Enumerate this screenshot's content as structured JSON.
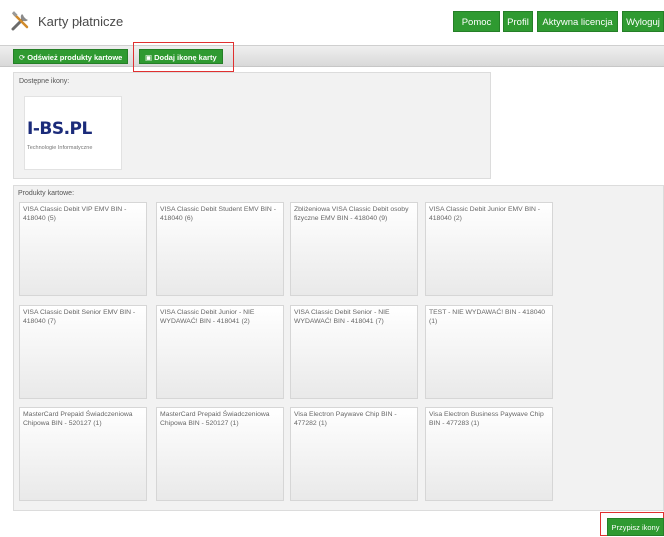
{
  "header": {
    "title": "Karty płatnicze",
    "icon": "tools-icon",
    "nav": [
      "Pomoc",
      "Profil",
      "Aktywna licencja",
      "Wyloguj"
    ]
  },
  "toolbar": {
    "refresh_label": "Odśwież produkty kartowe",
    "refresh_icon": "refresh-icon",
    "add_label": "Dodaj ikonę karty",
    "add_icon": "image-icon"
  },
  "icons_panel": {
    "label": "Dostępne ikony:",
    "logo_text": "I-BS.PL",
    "logo_sub": "Technologie Informatyczne"
  },
  "products": {
    "label": "Produkty kartowe:",
    "items": [
      "VISA Classic Debit VIP EMV BIN - 418040 (5)",
      "VISA Classic Debit Student EMV BIN - 418040 (6)",
      "Zbliżeniowa VISA Classic Debit osoby fizyczne EMV BIN - 418040 (9)",
      "VISA Classic Debit Junior EMV BIN - 418040 (2)",
      "VISA Classic Debit Senior EMV BIN - 418040 (7)",
      "VISA Classic Debit Junior - NIE WYDAWAĆ! BIN - 418041 (2)",
      "VISA Classic Debit Senior - NIE WYDAWAĆ! BIN - 418041 (7)",
      "TEST - NIE WYDAWAĆ! BIN - 418040 (1)",
      "MasterCard Prepaid Świadczeniowa Chipowa BIN - 520127 (1)",
      "MasterCard Prepaid Świadczeniowa Chipowa BIN - 520127 (1)",
      "Visa Electron Paywave Chip BIN - 477282 (1)",
      "Visa Electron Business Paywave Chip BIN - 477283 (1)"
    ]
  },
  "assign_label": "Przypisz ikony",
  "colors": {
    "accent": "#2f9a31",
    "highlight": "#e03030"
  }
}
